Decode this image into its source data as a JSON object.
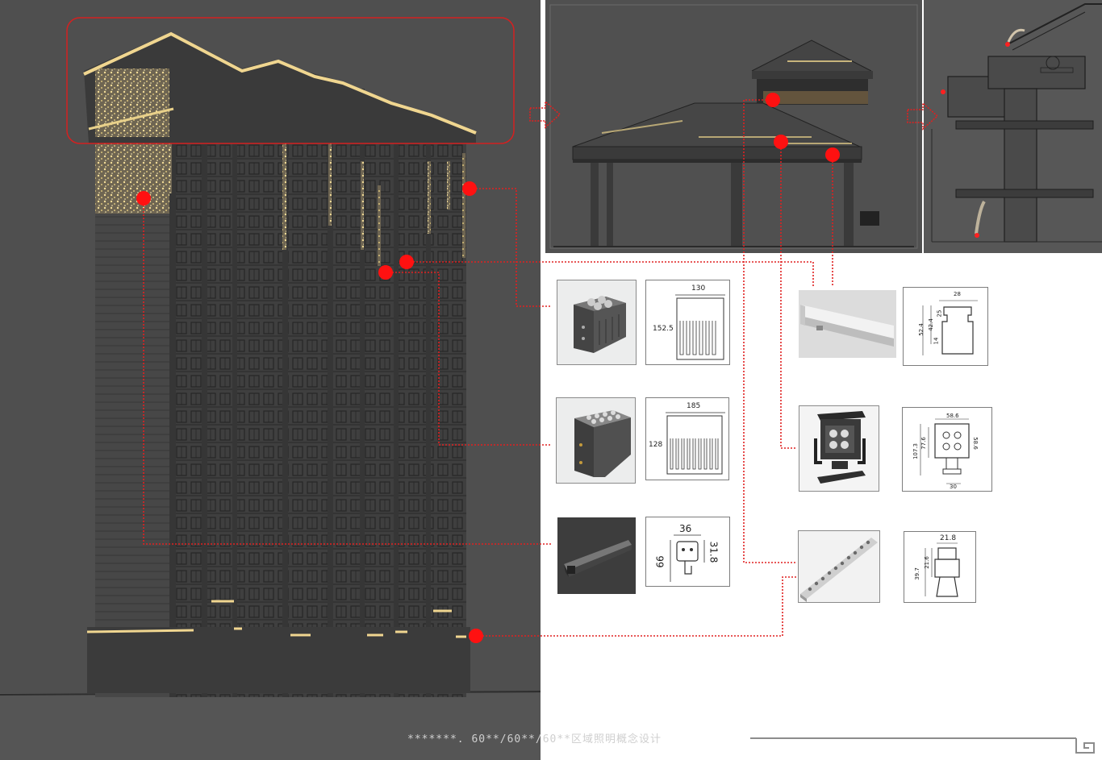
{
  "footer": {
    "title": "*******. 60**/60**/60**区域照明概念设计"
  },
  "fixtures": [
    {
      "id": "wallwasher-a",
      "name": "wall washer",
      "dims": [
        "130",
        "152.5"
      ]
    },
    {
      "id": "wallwasher-b",
      "name": "wall washer",
      "dims": [
        "185",
        "128"
      ]
    },
    {
      "id": "linear-wash",
      "name": "linear wash light",
      "dims": [
        "36",
        "66",
        "31.8"
      ]
    },
    {
      "id": "led-linear-tube",
      "name": "linear led tube",
      "dims": [
        "28",
        "25",
        "52.4",
        "42.4",
        "14"
      ]
    },
    {
      "id": "floodlight",
      "name": "floodlight",
      "dims": [
        "58.6",
        "107.3",
        "77.6",
        "58.6",
        "30"
      ]
    },
    {
      "id": "point-strip",
      "name": "point light strip",
      "dims": [
        "21.8",
        "39.7",
        "21.6"
      ]
    }
  ],
  "colors": {
    "marker": "#ff1111",
    "leader": "#e02020",
    "glow": "#e8d08a",
    "panel": "#4f4f4f"
  }
}
